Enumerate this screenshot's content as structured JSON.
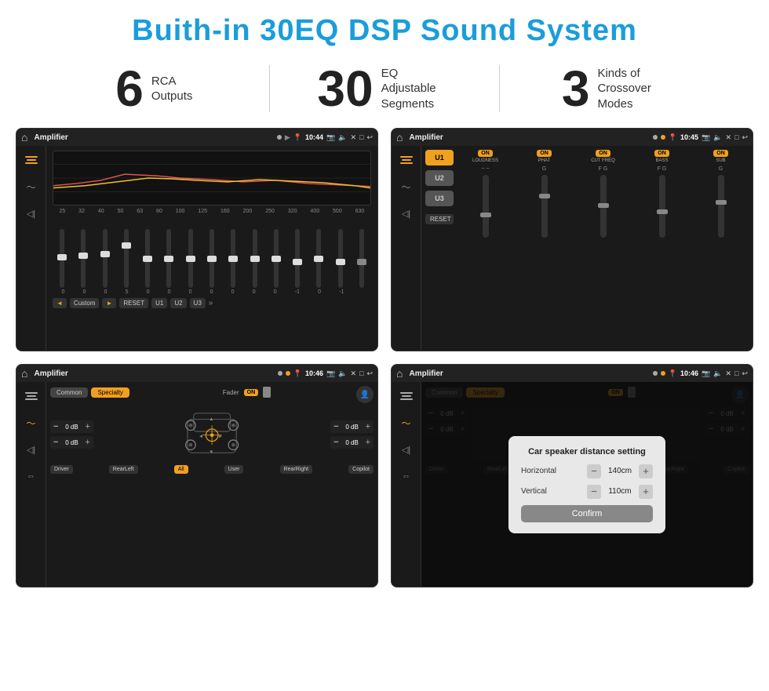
{
  "page": {
    "title": "Buith-in 30EQ DSP Sound System",
    "title_color": "#1a9ddb"
  },
  "stats": [
    {
      "number": "6",
      "label_line1": "RCA",
      "label_line2": "Outputs"
    },
    {
      "number": "30",
      "label_line1": "EQ Adjustable",
      "label_line2": "Segments"
    },
    {
      "number": "3",
      "label_line1": "Kinds of",
      "label_line2": "Crossover Modes"
    }
  ],
  "screens": [
    {
      "id": "screen1",
      "app_name": "Amplifier",
      "time": "10:44",
      "eq_labels": [
        "25",
        "32",
        "40",
        "50",
        "63",
        "80",
        "100",
        "125",
        "160",
        "200",
        "250",
        "320",
        "400",
        "500",
        "630"
      ],
      "eq_values": [
        "0",
        "0",
        "0",
        "5",
        "0",
        "0",
        "0",
        "0",
        "0",
        "0",
        "0",
        "-1",
        "0",
        "-1"
      ],
      "bottom_btns": [
        "◄",
        "Custom",
        "►",
        "RESET",
        "U1",
        "U2",
        "U3"
      ]
    },
    {
      "id": "screen2",
      "app_name": "Amplifier",
      "time": "10:45",
      "presets": [
        "U1",
        "U2",
        "U3"
      ],
      "channels": [
        {
          "toggle": "ON",
          "label": "LOUDNESS"
        },
        {
          "toggle": "ON",
          "label": "PHAT"
        },
        {
          "toggle": "ON",
          "label": "CUT FREQ"
        },
        {
          "toggle": "ON",
          "label": "BASS"
        },
        {
          "toggle": "ON",
          "label": "SUB"
        }
      ],
      "reset_label": "RESET"
    },
    {
      "id": "screen3",
      "app_name": "Amplifier",
      "time": "10:46",
      "tabs": [
        "Common",
        "Specialty"
      ],
      "active_tab": "Specialty",
      "fader_label": "Fader",
      "fader_on": "ON",
      "db_values": [
        "0 dB",
        "0 dB",
        "0 dB",
        "0 dB"
      ],
      "bottom_labels": [
        "Driver",
        "RearLeft",
        "All",
        "User",
        "RearRight",
        "Copilot"
      ]
    },
    {
      "id": "screen4",
      "app_name": "Amplifier",
      "time": "10:46",
      "tabs": [
        "Common",
        "Specialty"
      ],
      "dialog": {
        "title": "Car speaker distance setting",
        "horizontal_label": "Horizontal",
        "horizontal_value": "140cm",
        "vertical_label": "Vertical",
        "vertical_value": "110cm",
        "confirm_label": "Confirm",
        "db_values": [
          "0 dB",
          "0 dB"
        ]
      }
    }
  ]
}
